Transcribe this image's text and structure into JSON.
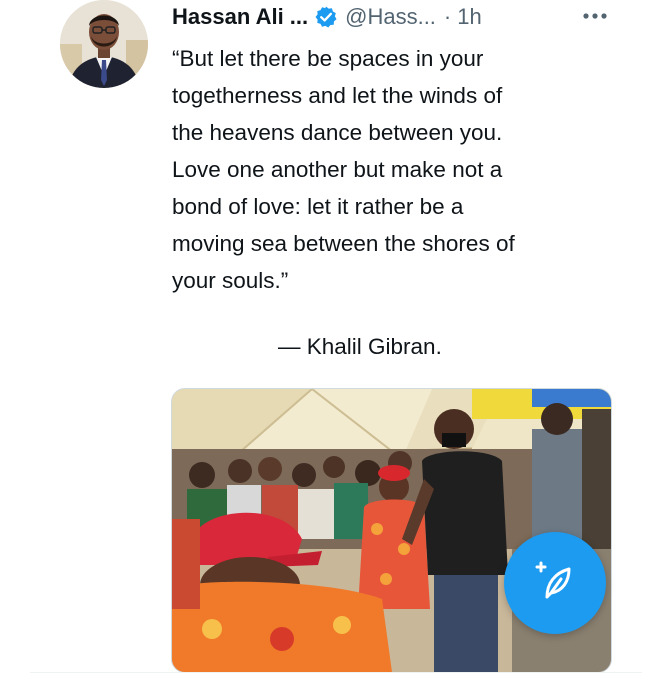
{
  "tweet": {
    "author_name": "Hassan Ali ...",
    "handle": "@Hass...",
    "separator": "·",
    "time": "1h",
    "text_lines": [
      "“But let there be spaces in your",
      "togetherness and let the winds of",
      "the heavens dance between you.",
      "Love one another but make not a",
      "bond of love: let it rather be a",
      "moving sea between the shores of",
      "your souls.”"
    ],
    "attribution": "— Khalil Gibran."
  },
  "icons": {
    "verified": "verified-badge-icon",
    "more": "more-options-icon",
    "compose": "compose-tweet-icon"
  },
  "colors": {
    "accent": "#1d9bf0",
    "text": "#0f1419",
    "secondary_text": "#536471"
  }
}
